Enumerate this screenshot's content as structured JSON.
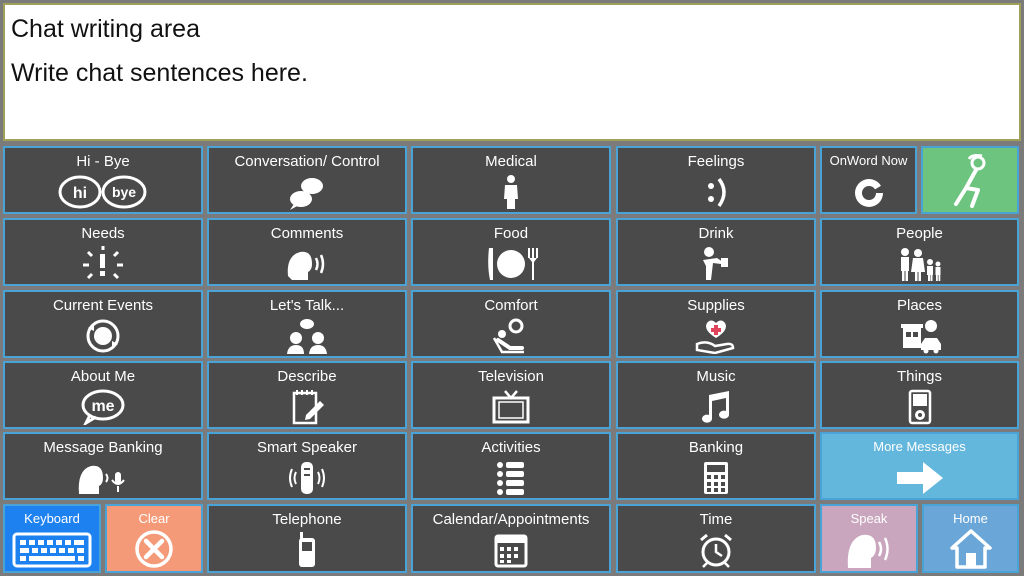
{
  "chat": {
    "title": "Chat writing area",
    "body": "Write chat sentences here."
  },
  "colors": {
    "tile": "#4a4a4a",
    "tile_border": "#4aa3d6",
    "green": "#6cc47f",
    "keyboard": "#1d82f0",
    "clear": "#f59a78",
    "more_messages": "#63b6dc",
    "speak": "#c9a6bd",
    "home": "#6ba6d8"
  },
  "tiles": {
    "hi_bye": {
      "label": "Hi - Bye",
      "icon": "hi-bye-bubbles-icon"
    },
    "conversation": {
      "label": "Conversation/ Control",
      "icon": "speech-bubbles-icon"
    },
    "medical": {
      "label": "Medical",
      "icon": "patient-figure-icon"
    },
    "feelings": {
      "label": "Feelings",
      "icon": "smiley-face-icon"
    },
    "onword": {
      "label": "OnWord Now",
      "icon": "onword-logo-icon"
    },
    "relax": {
      "label": "",
      "icon": "reclining-person-icon"
    },
    "needs": {
      "label": "Needs",
      "icon": "exclamation-burst-icon"
    },
    "comments": {
      "label": "Comments",
      "icon": "speaking-head-icon"
    },
    "food": {
      "label": "Food",
      "icon": "plate-knife-fork-icon"
    },
    "drink": {
      "label": "Drink",
      "icon": "drinking-person-icon"
    },
    "people": {
      "label": "People",
      "icon": "family-icon"
    },
    "current_events": {
      "label": "Current Events",
      "icon": "globe-arrows-icon"
    },
    "lets_talk": {
      "label": "Let's Talk...",
      "icon": "two-people-talking-icon"
    },
    "comfort": {
      "label": "Comfort",
      "icon": "reclining-comfort-icon"
    },
    "supplies": {
      "label": "Supplies",
      "icon": "hand-medical-cross-icon"
    },
    "places": {
      "label": "Places",
      "icon": "building-car-icon"
    },
    "about_me": {
      "label": "About Me",
      "icon": "me-bubble-icon"
    },
    "describe": {
      "label": "Describe",
      "icon": "notepad-pencil-icon"
    },
    "television": {
      "label": "Television",
      "icon": "tv-icon"
    },
    "music": {
      "label": "Music",
      "icon": "music-note-icon"
    },
    "things": {
      "label": "Things",
      "icon": "music-player-icon"
    },
    "message_banking": {
      "label": "Message Banking",
      "icon": "head-microphone-icon"
    },
    "smart_speaker": {
      "label": "Smart Speaker",
      "icon": "smart-speaker-icon"
    },
    "activities": {
      "label": "Activities",
      "icon": "checklist-icon"
    },
    "banking": {
      "label": "Banking",
      "icon": "calculator-icon"
    },
    "more_messages": {
      "label": "More Messages",
      "icon": "arrow-right-icon"
    },
    "keyboard": {
      "label": "Keyboard",
      "icon": "keyboard-icon"
    },
    "clear": {
      "label": "Clear",
      "icon": "clear-x-circle-icon"
    },
    "telephone": {
      "label": "Telephone",
      "icon": "mobile-phone-icon"
    },
    "calendar": {
      "label": "Calendar/Appointments",
      "icon": "calendar-icon"
    },
    "time": {
      "label": "Time",
      "icon": "alarm-clock-icon"
    },
    "speak": {
      "label": "Speak",
      "icon": "speaking-head-icon"
    },
    "home": {
      "label": "Home",
      "icon": "house-icon"
    }
  }
}
